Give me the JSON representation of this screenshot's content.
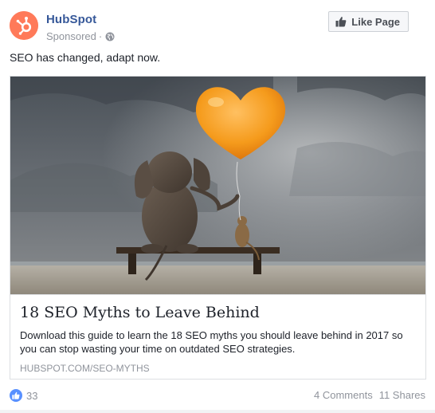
{
  "post": {
    "page_name": "HubSpot",
    "sponsored_label": "Sponsored",
    "separator": "·",
    "like_page_label": "Like Page",
    "text": "SEO has changed, adapt now."
  },
  "card": {
    "title": "18 SEO Myths to Leave Behind",
    "description": "Download this guide to learn the 18 SEO myths you should leave behind in 2017 so you can stop wasting your time on outdated SEO strategies.",
    "url": "HUBSPOT.COM/SEO-MYTHS"
  },
  "footer": {
    "like_count": "33",
    "comments": "4 Comments",
    "shares": "11 Shares"
  },
  "colors": {
    "brand": "#ff7a59",
    "link_blue": "#365899",
    "meta_gray": "#90949c",
    "reaction_blue": "#5890ff"
  },
  "icons": [
    "hubspot-logo-icon",
    "globe-icon",
    "thumbs-up-icon",
    "like-reaction-icon"
  ]
}
